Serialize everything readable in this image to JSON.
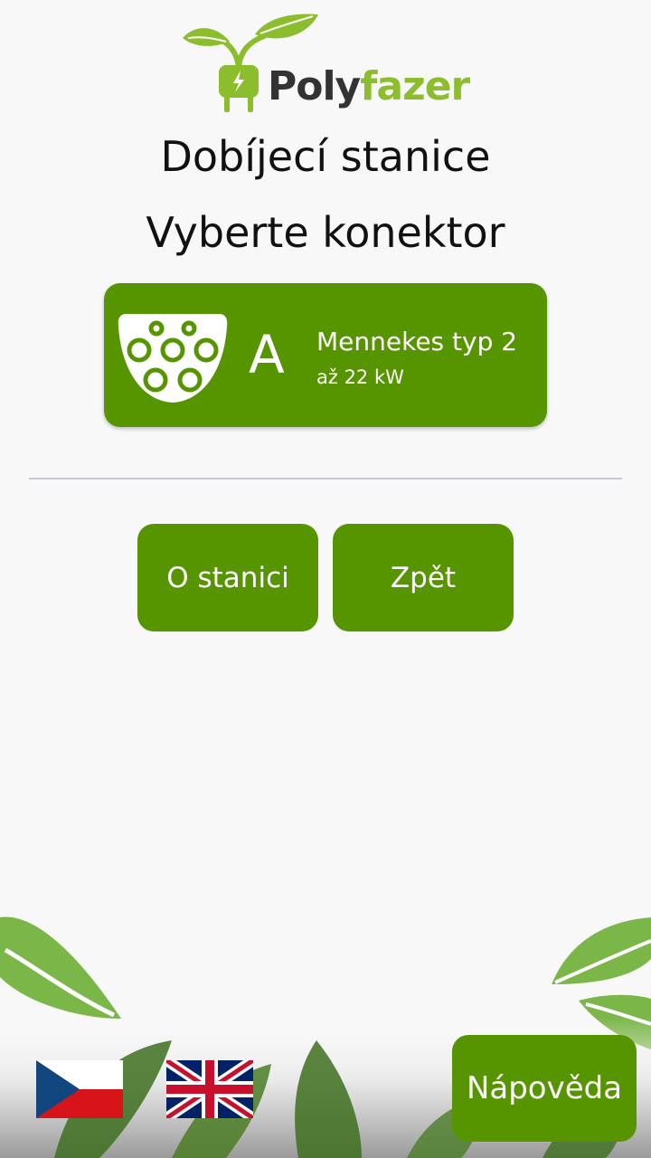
{
  "logo": {
    "text_left": "Poly",
    "text_right": "fazer",
    "colors": {
      "dark": "#333333",
      "green": "#8bbd2d"
    }
  },
  "header": {
    "title": "Dobíjecí stanice",
    "subtitle": "Vyberte konektor"
  },
  "connectors": [
    {
      "letter": "A",
      "name": "Mennekes typ 2",
      "power": "až 22 kW",
      "icon": "type2-plug-icon"
    }
  ],
  "actions": {
    "about_label": "O stanici",
    "back_label": "Zpět"
  },
  "footer": {
    "languages": [
      "cs",
      "en"
    ],
    "help_label": "Nápověda"
  },
  "theme": {
    "accent": "#579500",
    "background": "#f8f8f8",
    "leaf": "#7ab648"
  }
}
